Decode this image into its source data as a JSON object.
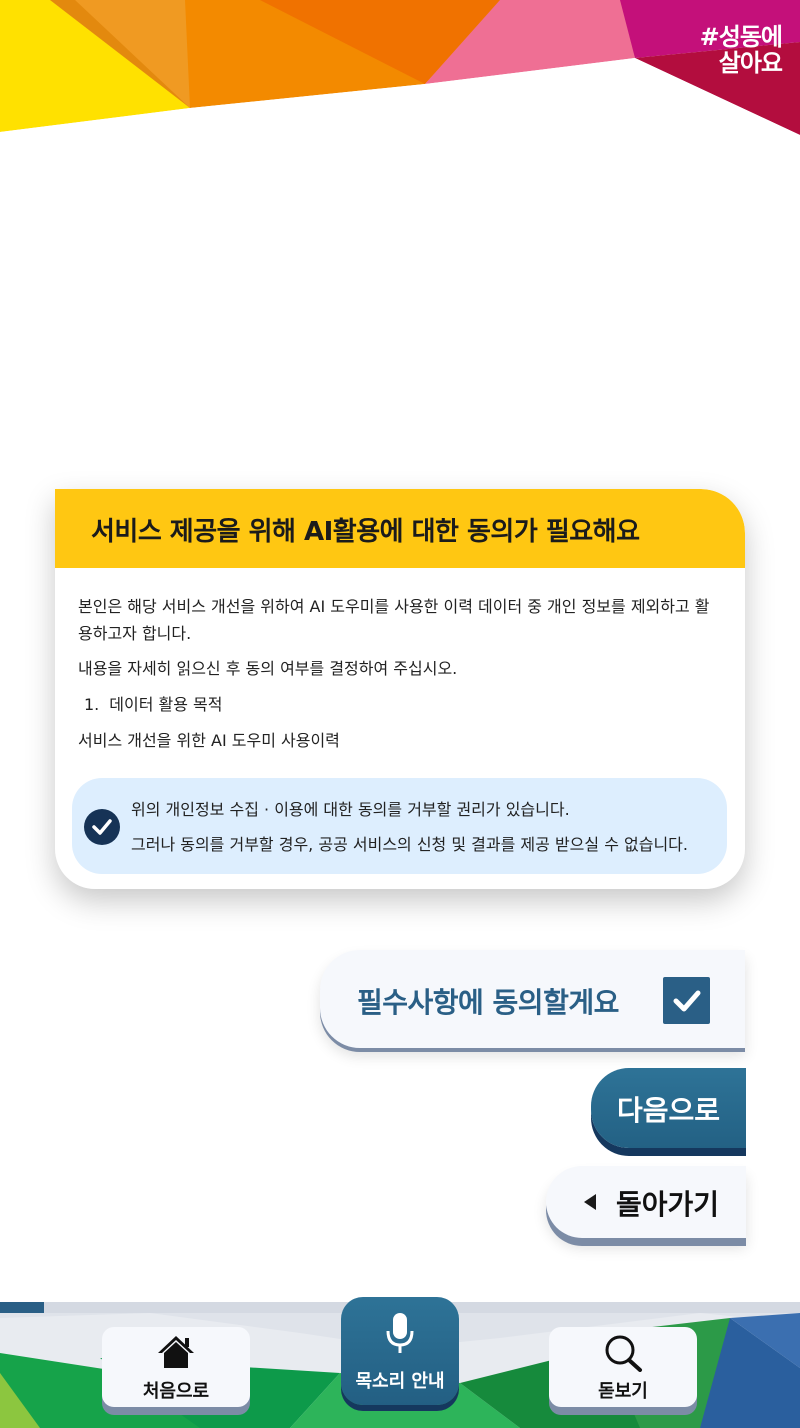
{
  "brand": {
    "line1": "#성동에",
    "line2": "살아요"
  },
  "consent": {
    "title": "서비스 제공을 위해 AI활용에 대한 동의가 필요해요",
    "paragraph1": "본인은 해당 서비스 개선을 위하여 AI 도우미를 사용한 이력 데이터 중 개인 정보를 제외하고 활용하고자 합니다.",
    "paragraph2": "내용을 자세히 읽으신 후 동의 여부를 결정하여 주십시오.",
    "item1_number": "1.",
    "item1_title": "데이터 활용 목적",
    "item1_body": "서비스 개선을 위한 AI 도우미 사용이력",
    "notice_line1": "위의 개인정보 수집 · 이용에 대한 동의를 거부할 권리가 있습니다.",
    "notice_line2": "그러나 동의를 거부할 경우, 공공 서비스의 신청 및 결과를 제공 받으실 수 없습니다."
  },
  "actions": {
    "agree_label": "필수사항에 동의할게요",
    "agree_checked": true,
    "next_label": "다음으로",
    "back_label": "돌아가기"
  },
  "bottom_nav": {
    "progress": 0.055,
    "home_label": "처음으로",
    "voice_label": "목소리 안내",
    "zoom_label": "돋보기"
  },
  "icons": {
    "check": "check-icon",
    "back": "triangle-left-icon",
    "home": "house-icon",
    "mic": "microphone-icon",
    "zoom": "magnifier-icon"
  },
  "colors": {
    "card_header": "#ffc712",
    "primary": "#2a5f86",
    "primary_dark": "#15385e",
    "notice_bg": "#ddeefe",
    "check_circle": "#163356"
  }
}
